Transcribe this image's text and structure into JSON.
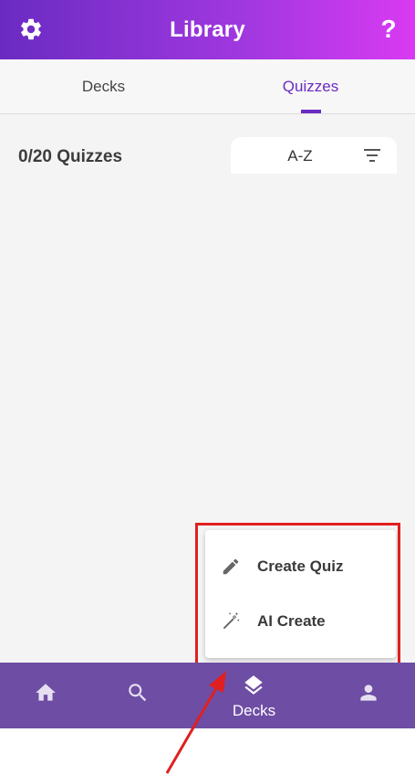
{
  "app_bar": {
    "title": "Library",
    "settings_icon": "gear-icon",
    "help_label": "?"
  },
  "tabs": [
    {
      "label": "Decks",
      "active": false
    },
    {
      "label": "Quizzes",
      "active": true
    }
  ],
  "content": {
    "count_label": "0/20 Quizzes",
    "sort": {
      "label": "A-Z",
      "icon": "filter-icon"
    }
  },
  "menu": {
    "items": [
      {
        "label": "Create Quiz",
        "icon": "pencil-icon"
      },
      {
        "label": "AI Create",
        "icon": "magic-wand-icon"
      }
    ]
  },
  "bottom_nav": {
    "items": [
      {
        "icon": "home-icon",
        "label": ""
      },
      {
        "icon": "search-icon",
        "label": ""
      },
      {
        "icon": "layers-icon",
        "label": "Decks"
      },
      {
        "icon": "person-icon",
        "label": ""
      }
    ]
  },
  "colors": {
    "accent": "#6a2bc2",
    "app_bar_gradient_start": "#6a2bc2",
    "app_bar_gradient_end": "#d93af2",
    "bottom_nav": "#6e4da4",
    "annotation": "#e02020"
  }
}
